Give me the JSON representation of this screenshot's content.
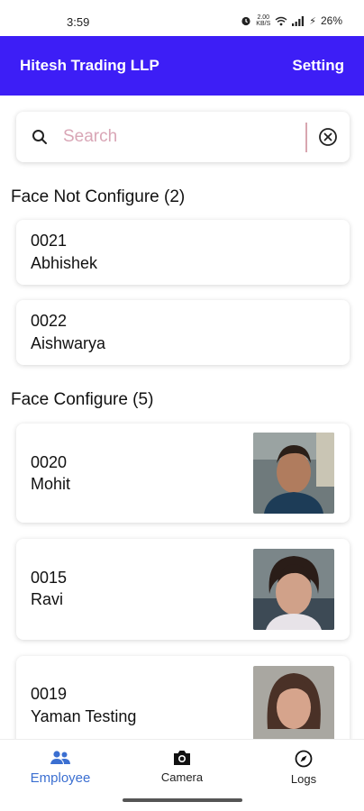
{
  "status_bar": {
    "time": "3:59",
    "net_speed_top": "2.00",
    "net_speed_bottom": "KB/S",
    "battery": "26%"
  },
  "header": {
    "title": "Hitesh Trading LLP",
    "action_label": "Setting",
    "color": "#3d1ef6"
  },
  "search": {
    "placeholder": "Search",
    "value": ""
  },
  "sections": {
    "not_configured": {
      "title": "Face Not Configure (2)",
      "items": [
        {
          "code": "0021",
          "name": "Abhishek"
        },
        {
          "code": "0022",
          "name": "Aishwarya"
        }
      ]
    },
    "configured": {
      "title": "Face Configure (5)",
      "items": [
        {
          "code": "0020",
          "name": "Mohit",
          "photo": "face-photo"
        },
        {
          "code": "0015",
          "name": "Ravi",
          "photo": "face-photo"
        },
        {
          "code": "0019",
          "name": "Yaman Testing",
          "photo": "face-photo"
        }
      ]
    }
  },
  "bottom_nav": {
    "items": [
      {
        "label": "Employee",
        "icon": "people-icon",
        "active": true
      },
      {
        "label": "Camera",
        "icon": "camera-icon",
        "active": false
      },
      {
        "label": "Logs",
        "icon": "compass-icon",
        "active": false
      }
    ],
    "active_color": "#3b6fd1"
  }
}
